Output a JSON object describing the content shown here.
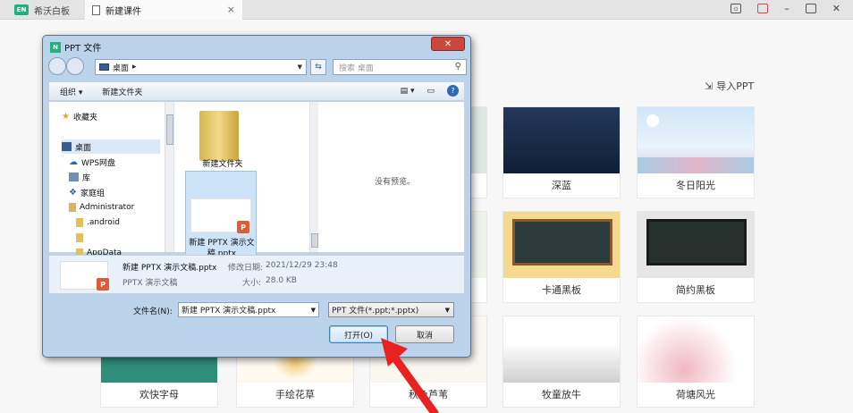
{
  "app": {
    "logo_text": "EN",
    "name": "希沃白板"
  },
  "tabs": [
    {
      "label": "新建课件",
      "close": "×"
    }
  ],
  "window_controls": {
    "minimize": "–"
  },
  "main": {
    "import_ppt_label": "导入PPT",
    "templates": [
      {
        "label": "深蓝"
      },
      {
        "label": "冬日阳光"
      },
      {
        "label": "卡通黑板"
      },
      {
        "label": "简约黑板"
      },
      {
        "label": "欢快字母"
      },
      {
        "label": "手绘花草"
      },
      {
        "label": "秋色芦苇"
      },
      {
        "label": "牧童放牛"
      },
      {
        "label": "荷塘风光"
      }
    ]
  },
  "dialog": {
    "title_icon_text": "N",
    "title": "PPT 文件",
    "close_glyph": "✕",
    "address": "桌面",
    "address_sep": "▸",
    "search_placeholder": "搜索 桌面",
    "toolbar": {
      "organize": "组织 ▾",
      "new_folder": "新建文件夹"
    },
    "nav_items": [
      {
        "label": "收藏夹",
        "icon": "star-icon"
      },
      {
        "label": "桌面",
        "icon": "desktop-icon"
      },
      {
        "label": "WPS网盘",
        "icon": "cloud-icon"
      },
      {
        "label": "库",
        "icon": "library-icon"
      },
      {
        "label": "家庭组",
        "icon": "homegroup-icon"
      },
      {
        "label": "Administrator",
        "icon": "user-icon"
      },
      {
        "label": ".android",
        "icon": "folder-icon"
      },
      {
        "label": "",
        "icon": "folder-icon"
      },
      {
        "label": "AppData",
        "icon": "folder-icon"
      }
    ],
    "files": [
      {
        "label": "新建文件夹",
        "type": "folder"
      },
      {
        "label": "新建 PPTX 演示文稿.pptx",
        "type": "pptx"
      }
    ],
    "ppt_badge": "P",
    "no_preview": "没有预览。",
    "details": {
      "name": "新建 PPTX 演示文稿.pptx",
      "modified_label": "修改日期:",
      "modified_value": "2021/12/29 23:48",
      "type": "PPTX 演示文稿",
      "size_label": "大小:",
      "size_value": "28.0 KB"
    },
    "filename_label": "文件名(N):",
    "filename_value": "新建 PPTX 演示文稿.pptx",
    "filetype_value": "PPT 文件(*.ppt;*.pptx)",
    "open_button": "打开(O)",
    "cancel_button": "取消"
  },
  "colors": {
    "accent_green": "#1fb37b",
    "close_red": "#c9473c",
    "annotation_arrow": "#e8231f"
  }
}
